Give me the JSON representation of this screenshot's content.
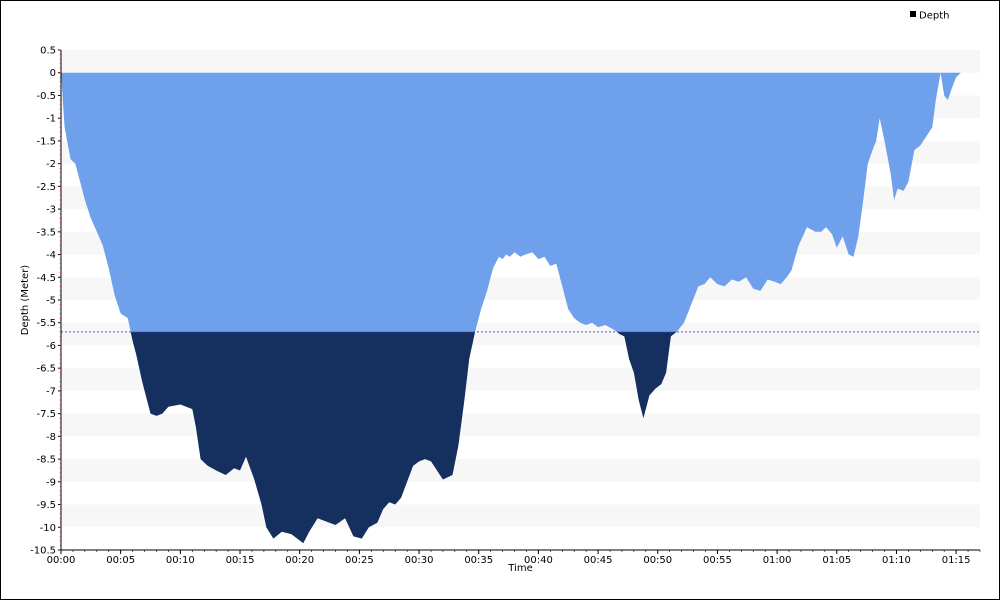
{
  "chart_data": {
    "type": "area",
    "xlabel": "Time",
    "ylabel": "Depth (Meter)",
    "legend": {
      "label": "Depth",
      "position": "top-right"
    },
    "ylim": [
      -10.5,
      0.5
    ],
    "y_ticks": [
      0.5,
      0,
      -0.5,
      -1,
      -1.5,
      -2,
      -2.5,
      -3,
      -3.5,
      -4,
      -4.5,
      -5,
      -5.5,
      -6,
      -6.5,
      -7,
      -7.5,
      -8,
      -8.5,
      -9,
      -9.5,
      -10,
      -10.5
    ],
    "y_tick_labels": [
      "0.5",
      "0",
      "-0.5",
      "-1",
      "-1.5",
      "-2",
      "-2.5",
      "-3",
      "-3.5",
      "-4",
      "-4.5",
      "-5",
      "-5.5",
      "-6",
      "-6.5",
      "-7",
      "-7.5",
      "-8",
      "-8.5",
      "-9",
      "-9.5",
      "-10",
      "-10.5"
    ],
    "xlim_minutes": [
      0,
      77
    ],
    "x_ticks_minutes": [
      0,
      5,
      10,
      15,
      20,
      25,
      30,
      35,
      40,
      45,
      50,
      55,
      60,
      65,
      70,
      75
    ],
    "x_tick_labels": [
      "00:00",
      "00:05",
      "00:10",
      "00:15",
      "00:20",
      "00:25",
      "00:30",
      "00:35",
      "00:40",
      "00:45",
      "00:50",
      "00:55",
      "01:00",
      "01:05",
      "01:10",
      "01:15"
    ],
    "threshold_depth": -5.7,
    "colors": {
      "shallow": "#6fa0ec",
      "deep": "#15305e",
      "threshold_line": "#5555cc",
      "band": "#f7f7f7"
    },
    "series": [
      {
        "name": "Depth",
        "x_minutes": [
          0,
          0.3,
          0.8,
          1.2,
          1.6,
          2.0,
          2.5,
          3.0,
          3.5,
          4.0,
          4.5,
          5.0,
          5.3,
          5.6,
          6.0,
          6.3,
          6.8,
          7.5,
          8.0,
          8.5,
          9.0,
          10.0,
          11.0,
          11.3,
          11.7,
          12.3,
          13.0,
          13.8,
          14.5,
          15.0,
          15.5,
          16.2,
          16.8,
          17.2,
          17.8,
          18.5,
          19.3,
          20.3,
          20.8,
          21.5,
          22.5,
          23.0,
          23.8,
          24.5,
          25.2,
          25.8,
          26.5,
          27.0,
          27.5,
          28.0,
          28.5,
          29.0,
          29.5,
          30.0,
          30.5,
          31.0,
          31.5,
          32.0,
          32.8,
          33.3,
          33.8,
          34.2,
          34.7,
          35.2,
          35.7,
          36.2,
          36.7,
          37.0,
          37.3,
          37.6,
          38.0,
          38.5,
          38.9,
          39.5,
          40.0,
          40.5,
          41.0,
          41.5,
          42.0,
          42.5,
          43.0,
          43.5,
          44.0,
          44.5,
          45.0,
          45.6,
          46.3,
          46.8,
          47.2,
          47.6,
          48.0,
          48.4,
          48.8,
          49.3,
          49.8,
          50.3,
          50.7,
          51.1,
          51.6,
          52.2,
          52.8,
          53.4,
          53.9,
          54.4,
          55.0,
          55.6,
          56.2,
          56.8,
          57.4,
          58.0,
          58.6,
          59.2,
          59.8,
          60.3,
          60.8,
          61.2,
          61.8,
          62.5,
          63.2,
          63.7,
          64.1,
          64.6,
          65.0,
          65.5,
          66.0,
          66.4,
          66.8,
          67.2,
          67.6,
          68.0,
          68.3,
          68.6,
          69.0,
          69.5,
          69.8,
          70.1,
          70.6,
          71.0,
          71.5,
          72.0,
          72.5,
          73.0,
          73.3,
          73.7,
          74.0,
          74.3,
          74.7,
          75.0,
          75.2,
          75.4
        ],
        "y": [
          0,
          -1.2,
          -1.9,
          -2.0,
          -2.4,
          -2.8,
          -3.2,
          -3.5,
          -3.8,
          -4.3,
          -4.9,
          -5.3,
          -5.35,
          -5.4,
          -5.9,
          -6.2,
          -6.8,
          -7.5,
          -7.55,
          -7.5,
          -7.35,
          -7.3,
          -7.4,
          -7.8,
          -8.5,
          -8.65,
          -8.75,
          -8.85,
          -8.7,
          -8.75,
          -8.45,
          -8.95,
          -9.5,
          -10.0,
          -10.25,
          -10.1,
          -10.15,
          -10.35,
          -10.1,
          -9.8,
          -9.9,
          -9.95,
          -9.8,
          -10.2,
          -10.25,
          -10.0,
          -9.9,
          -9.6,
          -9.45,
          -9.5,
          -9.35,
          -9.0,
          -8.65,
          -8.55,
          -8.5,
          -8.55,
          -8.75,
          -8.95,
          -8.85,
          -8.2,
          -7.2,
          -6.3,
          -5.7,
          -5.2,
          -4.8,
          -4.3,
          -4.05,
          -4.1,
          -4.0,
          -4.05,
          -3.95,
          -4.05,
          -4.0,
          -3.95,
          -4.1,
          -4.05,
          -4.25,
          -4.2,
          -4.7,
          -5.2,
          -5.4,
          -5.5,
          -5.55,
          -5.5,
          -5.6,
          -5.55,
          -5.65,
          -5.75,
          -5.8,
          -6.3,
          -6.6,
          -7.2,
          -7.6,
          -7.1,
          -6.95,
          -6.85,
          -6.6,
          -5.8,
          -5.7,
          -5.5,
          -5.1,
          -4.7,
          -4.65,
          -4.5,
          -4.65,
          -4.7,
          -4.55,
          -4.6,
          -4.5,
          -4.75,
          -4.8,
          -4.55,
          -4.6,
          -4.65,
          -4.5,
          -4.35,
          -3.8,
          -3.4,
          -3.5,
          -3.5,
          -3.4,
          -3.55,
          -3.85,
          -3.6,
          -4.0,
          -4.05,
          -3.6,
          -2.85,
          -2.0,
          -1.7,
          -1.5,
          -1.0,
          -1.5,
          -2.2,
          -2.8,
          -2.55,
          -2.6,
          -2.4,
          -1.7,
          -1.6,
          -1.4,
          -1.2,
          -0.6,
          0,
          -0.5,
          -0.6,
          -0.3,
          -0.1,
          -0.05,
          0
        ]
      }
    ]
  }
}
